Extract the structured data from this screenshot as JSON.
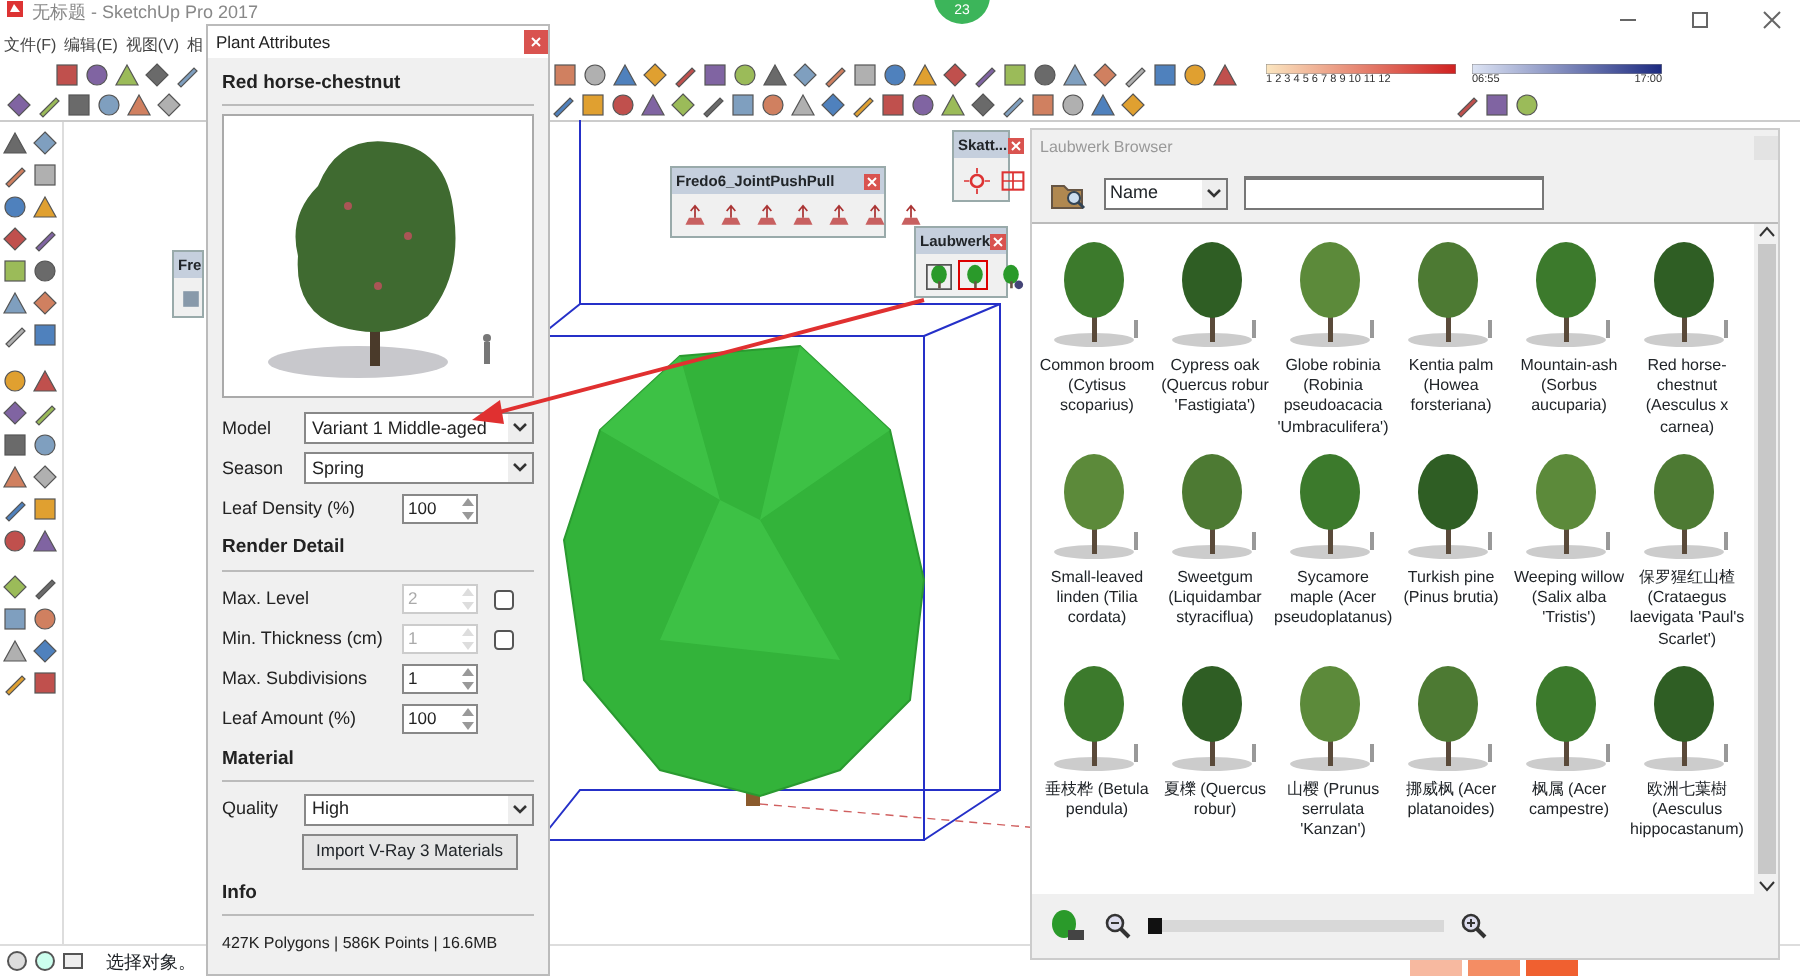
{
  "window": {
    "title": "无标题 - SketchUp Pro 2017"
  },
  "menu": [
    "文件(F)",
    "编辑(E)",
    "视图(V)",
    "相"
  ],
  "notification_badge": "23",
  "shadow_settings": {
    "months": "1 2 3 4 5 6 7 8 9 10 11 12",
    "time_start": "06:55",
    "time_end": "17:00"
  },
  "floating_toolbars": [
    {
      "kind": "stub",
      "title": "Fre"
    },
    {
      "kind": "pushpull",
      "title": "Fredo6_JointPushPull"
    },
    {
      "kind": "skatter",
      "title": "Skatt..."
    },
    {
      "kind": "laubwerk",
      "title": "Laubwerk"
    }
  ],
  "plant_attributes": {
    "title": "Plant Attributes",
    "plant_name": "Red horse-chestnut",
    "sections": [
      {
        "fields": [
          {
            "kind": "select",
            "label": "Model",
            "value": "Variant 1 Middle-aged"
          },
          {
            "kind": "select",
            "label": "Season",
            "value": "Spring"
          },
          {
            "kind": "spin",
            "label": "Leaf Density (%)",
            "value": "100",
            "disabled": false
          }
        ]
      },
      {
        "heading": "Render Detail",
        "fields": [
          {
            "kind": "spin-check",
            "label": "Max. Level",
            "value": "2",
            "disabled": true,
            "checked": false
          },
          {
            "kind": "spin-check",
            "label": "Min. Thickness (cm)",
            "value": "1",
            "disabled": true,
            "checked": false
          },
          {
            "kind": "spin",
            "label": "Max. Subdivisions",
            "value": "1",
            "disabled": false
          },
          {
            "kind": "spin",
            "label": "Leaf Amount (%)",
            "value": "100",
            "disabled": false
          }
        ]
      },
      {
        "heading": "Material",
        "fields": [
          {
            "kind": "select",
            "label": "Quality",
            "value": "High"
          },
          {
            "kind": "button",
            "label": "Import V-Ray 3 Materials"
          }
        ]
      },
      {
        "heading": "Info",
        "fields": [
          {
            "kind": "text",
            "label": "427K Polygons | 586K Points | 16.6MB"
          }
        ]
      }
    ]
  },
  "browser": {
    "title": "Laubwerk Browser",
    "sort_by": "Name",
    "plants": [
      {
        "name": "Common broom (Cytisus scoparius)"
      },
      {
        "name": "Cypress oak (Quercus robur 'Fastigiata')"
      },
      {
        "name": "Globe robinia (Robinia pseudoacacia 'Umbraculifera')"
      },
      {
        "name": "Kentia palm (Howea forsteriana)"
      },
      {
        "name": "Mountain-ash (Sorbus aucuparia)"
      },
      {
        "name": "Red horse-chestnut (Aesculus x carnea)"
      },
      {
        "name": "Small-leaved linden (Tilia cordata)"
      },
      {
        "name": "Sweetgum (Liquidambar styraciflua)"
      },
      {
        "name": "Sycamore maple (Acer pseudoplatanus)"
      },
      {
        "name": "Turkish pine (Pinus brutia)"
      },
      {
        "name": "Weeping willow (Salix alba 'Tristis')"
      },
      {
        "name": "保罗猩红山楂 (Crataegus laevigata 'Paul's Scarlet')"
      },
      {
        "name": "垂枝桦 (Betula pendula)"
      },
      {
        "name": "夏櫟 (Quercus robur)"
      },
      {
        "name": "山樱 (Prunus serrulata 'Kanzan')"
      },
      {
        "name": "挪威枫 (Acer platanoides)"
      },
      {
        "name": "枫属 (Acer campestre)"
      },
      {
        "name": "欧洲七葉樹 (Aesculus hippocastanum)"
      }
    ],
    "zoom": {
      "level": 0
    }
  },
  "status_bar": {
    "text": "选择对象。"
  }
}
